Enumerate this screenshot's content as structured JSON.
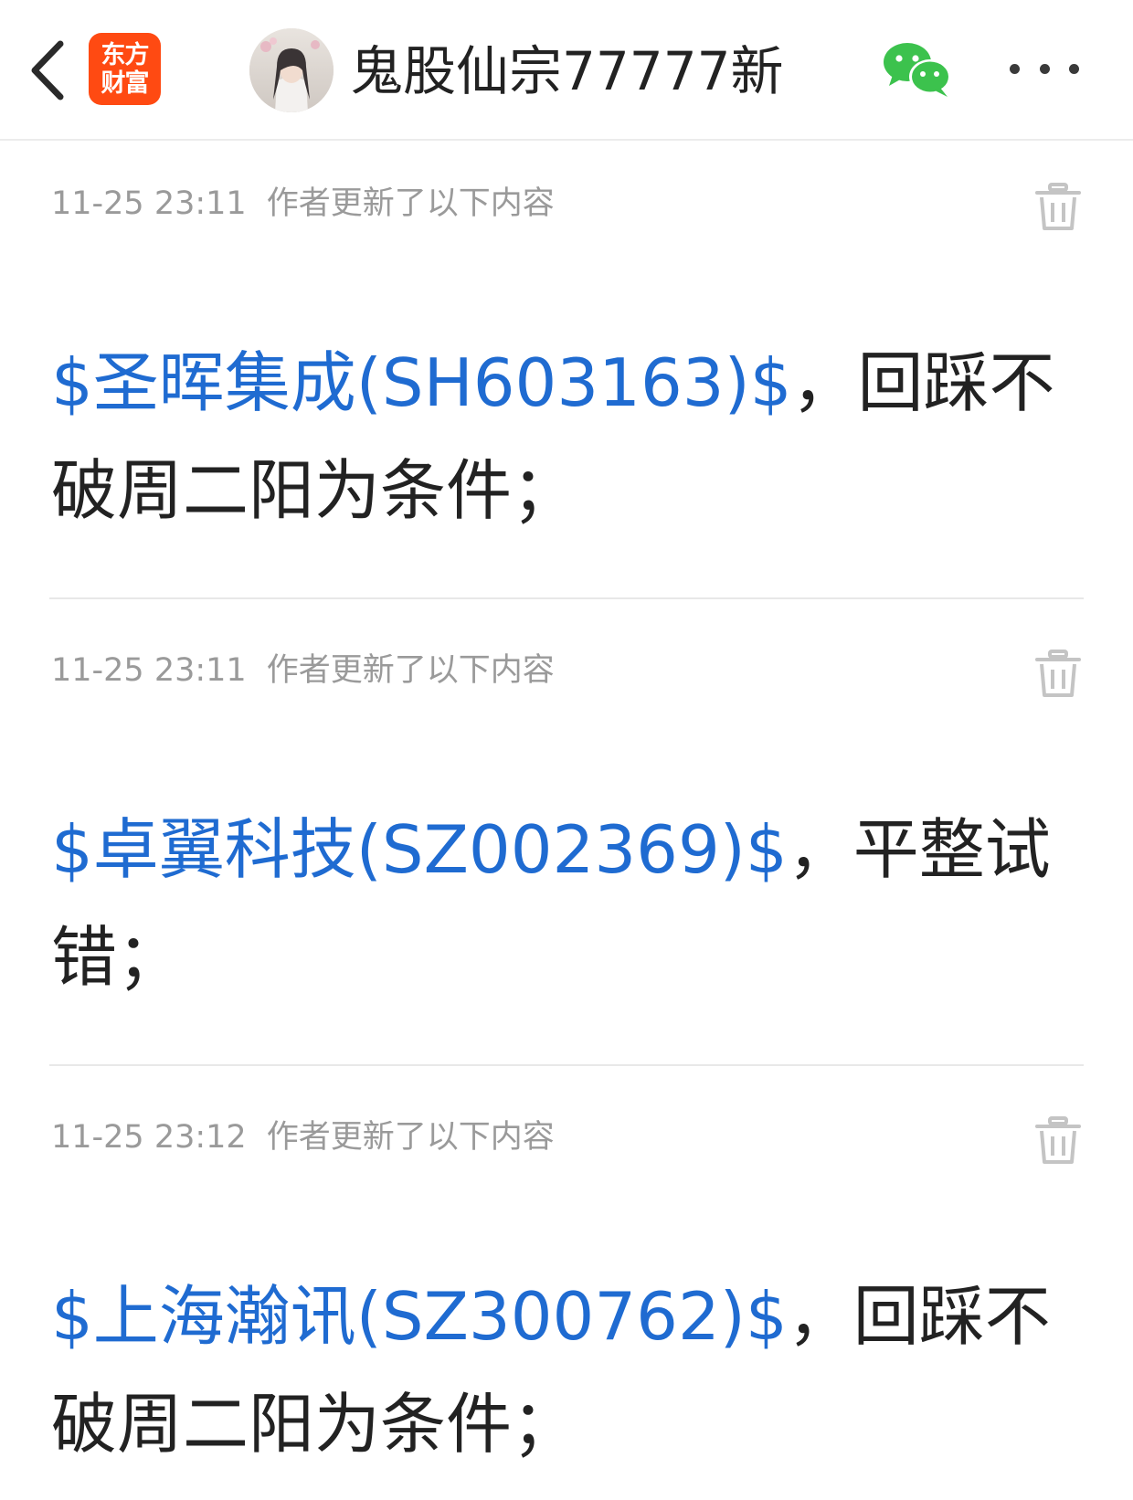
{
  "header": {
    "logo_line1": "东方",
    "logo_line2": "财富",
    "author_name": "鬼股仙宗77777新"
  },
  "colors": {
    "link": "#1f6bd1",
    "logo_bg": "#ff4a12",
    "wechat_green": "#3cc24d",
    "meta_gray": "#9a9a9a"
  },
  "icons": {
    "back": "chevron-left-icon",
    "share": "wechat-icon",
    "more": "more-dots-icon",
    "delete": "trash-icon"
  },
  "updates": [
    {
      "time": "11-25 23:11",
      "label": "作者更新了以下内容",
      "stock": "$圣晖集成(SH603163)$",
      "text": "，回踩不破周二阳为条件；"
    },
    {
      "time": "11-25 23:11",
      "label": "作者更新了以下内容",
      "stock": "$卓翼科技(SZ002369)$",
      "text": "，平整试错；"
    },
    {
      "time": "11-25 23:12",
      "label": "作者更新了以下内容",
      "stock": "$上海瀚讯(SZ300762)$",
      "text": "，回踩不破周二阳为条件；"
    }
  ]
}
